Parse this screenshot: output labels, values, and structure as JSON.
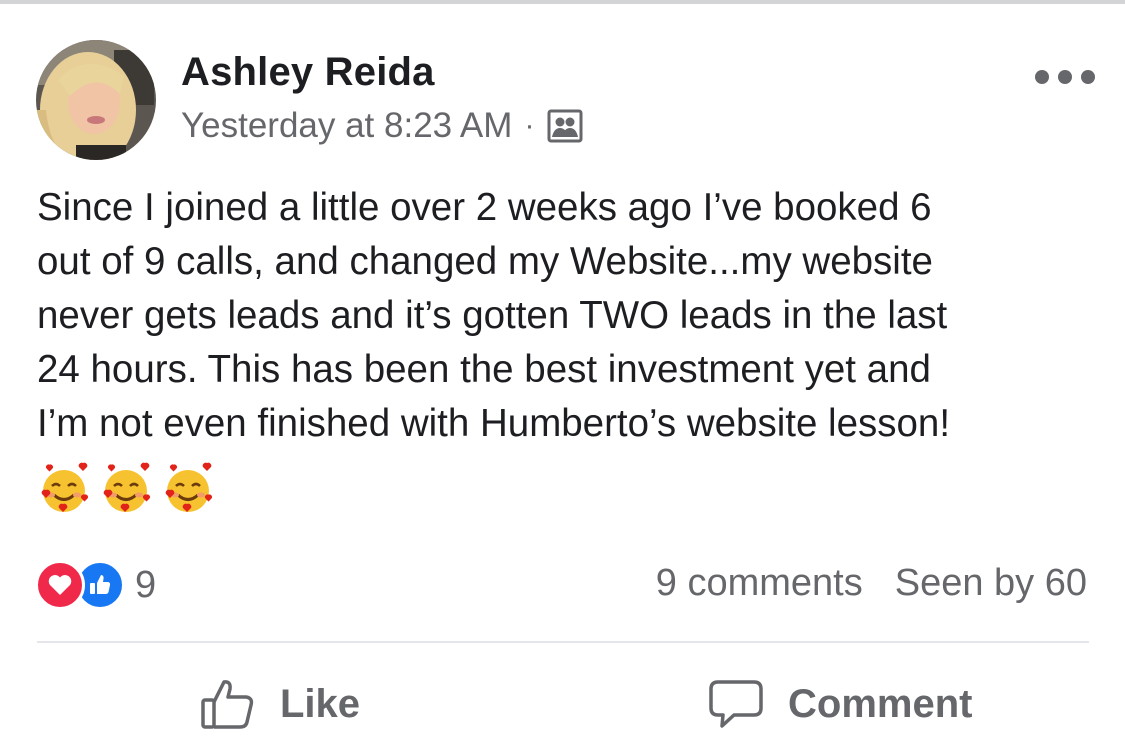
{
  "post": {
    "author": "Ashley Reida",
    "timestamp": "Yesterday at 8:23 AM",
    "separator": "·",
    "audience_icon": "group-audience-icon",
    "text": "Since I joined a little over 2 weeks ago I’ve booked 6\nout of 9 calls, and changed my Website...my website\nnever gets leads and it’s gotten TWO leads in the last\n24 hours. This has been the best investment yet and\nI’m not even finished with Humberto’s website lesson!",
    "emojis": [
      "🥰",
      "🥰",
      "🥰"
    ]
  },
  "reactions": {
    "types": [
      "love",
      "like"
    ],
    "count": "9"
  },
  "stats": {
    "comments": "9 comments",
    "seen_by": "Seen by 60"
  },
  "actions": {
    "like_label": "Like",
    "comment_label": "Comment"
  },
  "colors": {
    "love": "#f0284a",
    "like": "#1877f2",
    "text_secondary": "#65676b"
  }
}
